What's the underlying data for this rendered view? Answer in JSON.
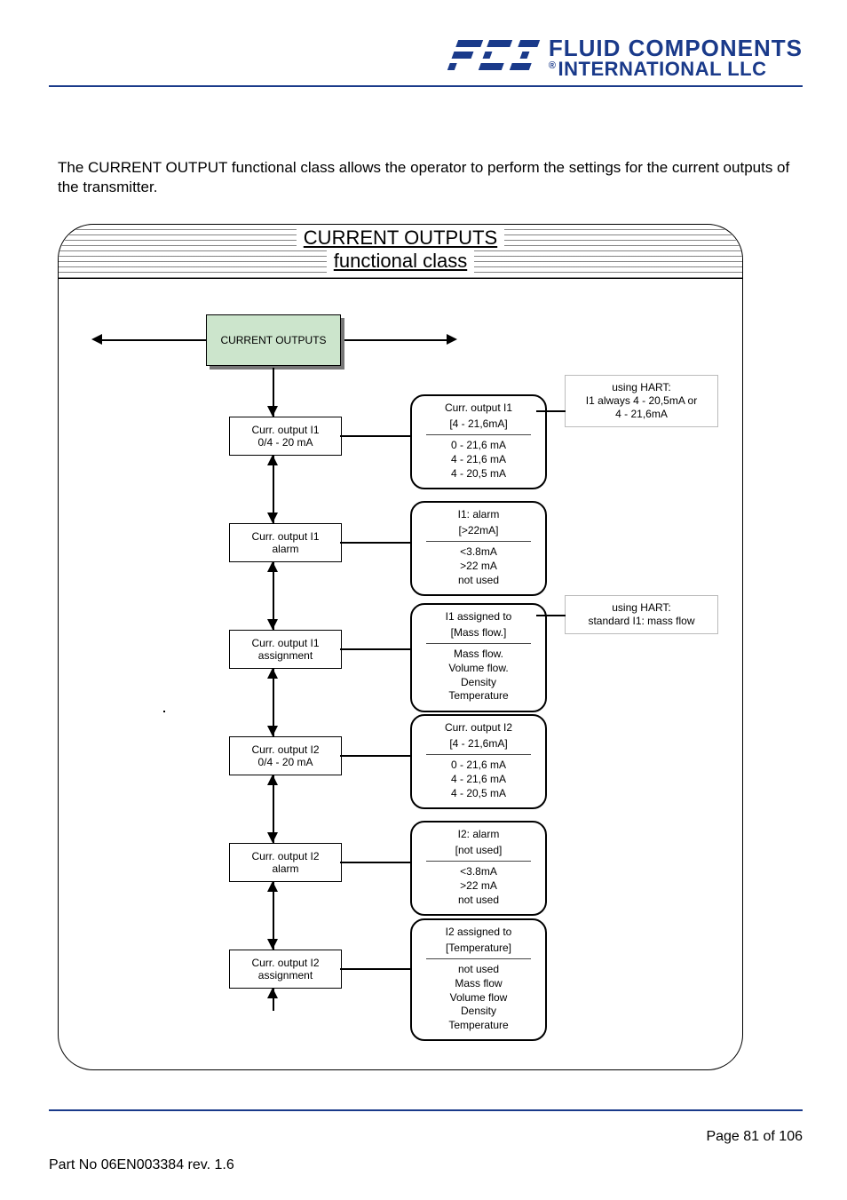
{
  "header": {
    "logo_line1": "FLUID COMPONENTS",
    "logo_line2": "INTERNATIONAL LLC",
    "logo_abbr": "FCI",
    "registered": "®"
  },
  "intro": "The CURRENT OUTPUT functional class allows the operator to perform the settings for the current outputs of the transmitter.",
  "diagram": {
    "title1": "CURRENT OUTPUTS",
    "title2": "functional class",
    "main_box": "CURRENT OUTPUTS",
    "rows": [
      {
        "menu_l1": "Curr. output  I1",
        "menu_l2": "0/4 - 20 mA",
        "opt_t1": "Curr. output  I1",
        "opt_t2": "[4 - 21,6mA]",
        "opt_vals": [
          "0 - 21,6 mA",
          "4 - 21,6 mA",
          "4 - 20,5 mA"
        ],
        "note": "using HART:\nI1 always 4 - 20,5mA or\n4 - 21,6mA"
      },
      {
        "menu_l1": "Curr. output  I1",
        "menu_l2": "alarm",
        "opt_t1": "I1: alarm",
        "opt_t2": "[>22mA]",
        "opt_vals": [
          "<3.8mA",
          ">22 mA",
          "not used"
        ]
      },
      {
        "menu_l1": "Curr. output  I1",
        "menu_l2": "assignment",
        "opt_t1": "I1 assigned to",
        "opt_t2": "[Mass flow.]",
        "opt_vals": [
          "Mass flow.",
          "Volume flow.",
          "Density",
          "Temperature"
        ],
        "note": "using HART:\nstandard I1: mass flow"
      },
      {
        "menu_l1": "Curr. output  I2",
        "menu_l2": "0/4 - 20 mA",
        "opt_t1": "Curr. output I2",
        "opt_t2": "[4 - 21,6mA]",
        "opt_vals": [
          "0 - 21,6 mA",
          "4 - 21,6 mA",
          "4 - 20,5 mA"
        ]
      },
      {
        "menu_l1": "Curr. output  I2",
        "menu_l2": "alarm",
        "opt_t1": "I2: alarm",
        "opt_t2": "[not used]",
        "opt_vals": [
          "<3.8mA",
          ">22 mA",
          "not used"
        ]
      },
      {
        "menu_l1": "Curr. output  I2",
        "menu_l2": "assignment",
        "opt_t1": "I2 assigned to",
        "opt_t2": "[Temperature]",
        "opt_vals": [
          "not used",
          "Mass flow",
          "Volume flow",
          "Density",
          "Temperature"
        ]
      }
    ]
  },
  "footer": {
    "left": "Part No 06EN003384 rev. 1.6",
    "right": "Page 81 of 106"
  }
}
